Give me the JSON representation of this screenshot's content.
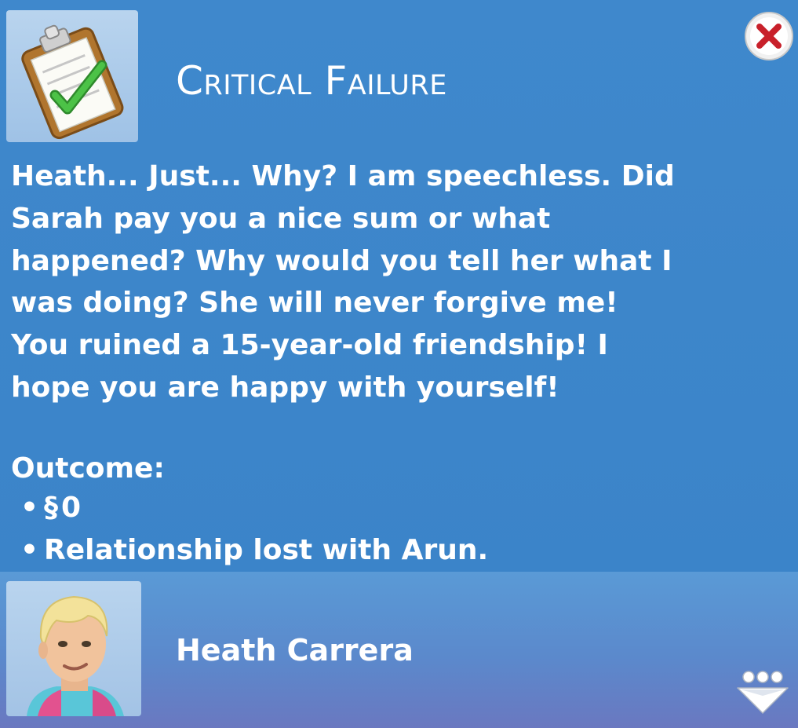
{
  "dialog": {
    "title": "Critical Failure",
    "message_lines": [
      "Heath... Just... Why? I am speechless. Did",
      "Sarah pay you a nice sum or what",
      "happened? Why would you tell her what I",
      "was doing? She will never forgive me!",
      "You ruined a 15-year-old friendship! I",
      "hope you are happy with yourself!"
    ],
    "outcome_label": "Outcome:",
    "outcome_items": [
      {
        "bullet": "•",
        "currency_symbol": "§",
        "text": "0"
      },
      {
        "bullet": "•",
        "text": "Relationship lost with Arun."
      }
    ]
  },
  "footer": {
    "sim_name": "Heath Carrera"
  },
  "icons": {
    "task": "clipboard-check-icon",
    "close": "close-icon",
    "avatar": "sim-portrait",
    "more": "more-options-icon"
  },
  "colors": {
    "panel_blue": "#3a84c9",
    "footer_blue": "#5b89cc",
    "close_red": "#c8202a",
    "check_green": "#3aa935"
  }
}
